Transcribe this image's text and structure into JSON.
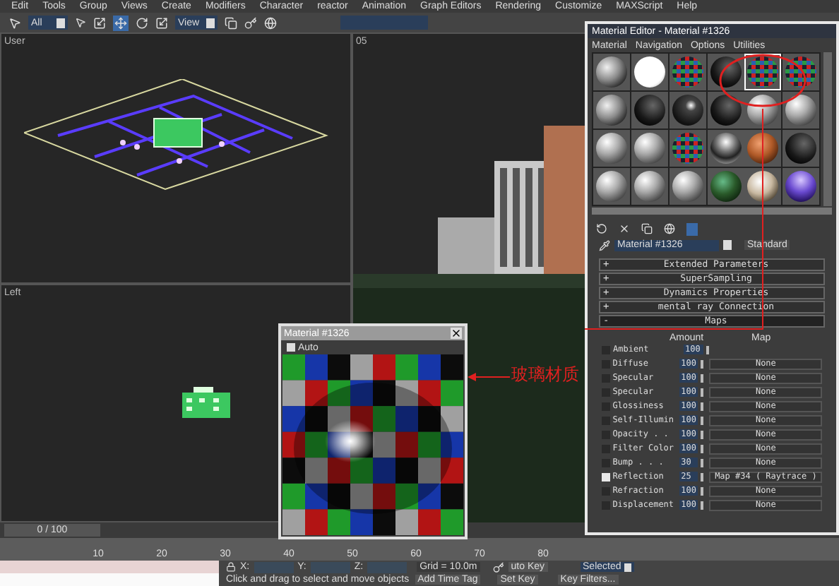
{
  "menu_bar": [
    "Edit",
    "Tools",
    "Group",
    "Views",
    "Create",
    "Modifiers",
    "Character",
    "reactor",
    "Animation",
    "Graph Editors",
    "Rendering",
    "Customize",
    "MAXScript",
    "Help"
  ],
  "toolbar": {
    "selection_filter": "All",
    "coordinate_system": "View"
  },
  "viewports": [
    {
      "label": "User",
      "kind": "plan"
    },
    {
      "label": "Left",
      "kind": "elevation"
    },
    {
      "label": "05",
      "kind": "render"
    }
  ],
  "material_editor": {
    "title": "Material Editor - Material #1326",
    "menu": [
      "Material",
      "Navigation",
      "Options",
      "Utilities"
    ],
    "slots": [
      {
        "kind": "stone",
        "selected": false
      },
      {
        "kind": "white",
        "selected": false
      },
      {
        "kind": "checker",
        "selected": false
      },
      {
        "kind": "dark",
        "selected": false
      },
      {
        "kind": "checker",
        "selected": true
      },
      {
        "kind": "checker",
        "selected": false
      },
      {
        "kind": "stone",
        "selected": false
      },
      {
        "kind": "dark",
        "selected": false
      },
      {
        "kind": "glossy",
        "selected": false
      },
      {
        "kind": "dark",
        "selected": false
      },
      {
        "kind": "grey",
        "selected": false
      },
      {
        "kind": "grey",
        "selected": false
      },
      {
        "kind": "grey",
        "selected": false
      },
      {
        "kind": "grey",
        "selected": false
      },
      {
        "kind": "checker",
        "selected": false
      },
      {
        "kind": "chrome",
        "selected": false
      },
      {
        "kind": "wood",
        "selected": false
      },
      {
        "kind": "dark",
        "selected": false
      },
      {
        "kind": "grey",
        "selected": false
      },
      {
        "kind": "grey",
        "selected": false
      },
      {
        "kind": "grey",
        "selected": false
      },
      {
        "kind": "green",
        "selected": false
      },
      {
        "kind": "marble",
        "selected": false
      },
      {
        "kind": "purple",
        "selected": false
      }
    ],
    "material_name": "Material #1326",
    "material_type": "Standard",
    "rollouts": [
      {
        "sign": "+",
        "title": "Extended Parameters",
        "expanded": false
      },
      {
        "sign": "+",
        "title": "SuperSampling",
        "expanded": false
      },
      {
        "sign": "+",
        "title": "Dynamics Properties",
        "expanded": false
      },
      {
        "sign": "+",
        "title": "mental ray Connection",
        "expanded": false
      },
      {
        "sign": "-",
        "title": "Maps",
        "expanded": true
      }
    ],
    "map_columns": [
      "Amount",
      "Map"
    ],
    "maps": [
      {
        "name": "Ambient",
        "checked": false,
        "amount": "100"
      },
      {
        "name": "Diffuse",
        "checked": false,
        "amount": "100",
        "map": "None"
      },
      {
        "name": "Specular",
        "checked": false,
        "amount": "100",
        "map": "None"
      },
      {
        "name": "Specular",
        "checked": false,
        "amount": "100",
        "map": "None"
      },
      {
        "name": "Glossiness",
        "checked": false,
        "amount": "100",
        "map": "None"
      },
      {
        "name": "Self-Illumin",
        "checked": false,
        "amount": "100",
        "map": "None"
      },
      {
        "name": "Opacity . .",
        "checked": false,
        "amount": "100",
        "map": "None"
      },
      {
        "name": "Filter Color",
        "checked": false,
        "amount": "100",
        "map": "None"
      },
      {
        "name": "Bump . . .",
        "checked": false,
        "amount": "30",
        "map": "None"
      },
      {
        "name": "Reflection",
        "checked": true,
        "amount": "25",
        "map": "Map #34  ( Raytrace )"
      },
      {
        "name": "Refraction",
        "checked": false,
        "amount": "100",
        "map": "None"
      },
      {
        "name": "Displacement",
        "checked": false,
        "amount": "100",
        "map": "None"
      }
    ]
  },
  "preview_window": {
    "title": "Material #1326",
    "auto_label": "Auto",
    "auto_checked": true
  },
  "annotation": {
    "label": "玻璃材质"
  },
  "timeline": {
    "position": "0 / 100",
    "ticks": [
      "10",
      "20",
      "30",
      "40",
      "50",
      "60",
      "70",
      "80"
    ]
  },
  "status_bar": {
    "x_label": "X:",
    "y_label": "Y:",
    "z_label": "Z:",
    "grid": "Grid = 10.0m",
    "auto_key": "uto Key",
    "set_key": "Set Key",
    "key_mode": "Selected",
    "key_filters": "Key Filters...",
    "prompt": "Click and drag to select and move objects",
    "time_tag": "Add Time Tag"
  }
}
